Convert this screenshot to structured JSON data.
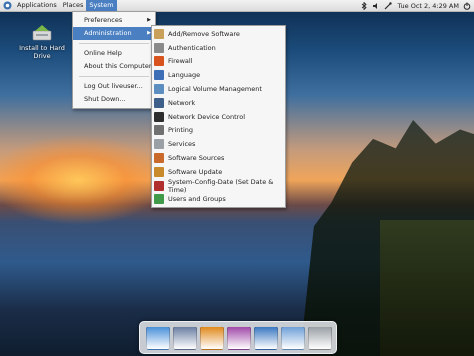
{
  "top_panel": {
    "menus": [
      {
        "label": "Applications"
      },
      {
        "label": "Places"
      },
      {
        "label": "System"
      }
    ],
    "clock": "Tue Oct 2,  4:29 AM",
    "tray_icons": [
      "bluetooth-icon",
      "speaker-icon",
      "network-icon"
    ]
  },
  "desktop": {
    "icon_label": "Install to Hard Drive"
  },
  "system_menu": {
    "items": [
      {
        "label": "Preferences",
        "has_submenu": true
      },
      {
        "label": "Administration",
        "has_submenu": true,
        "highlighted": true
      },
      {
        "label": "Online Help"
      },
      {
        "label": "About this Computer"
      },
      {
        "label": "Log Out liveuser..."
      },
      {
        "label": "Shut Down..."
      }
    ],
    "arrow_glyph": "▶"
  },
  "administration_menu": {
    "items": [
      {
        "label": "Add/Remove Software",
        "icon": "package-icon",
        "color": "#c8a05a"
      },
      {
        "label": "Authentication",
        "icon": "keys-icon",
        "color": "#8a8a8a"
      },
      {
        "label": "Firewall",
        "icon": "firewall-icon",
        "color": "#d9531e"
      },
      {
        "label": "Language",
        "icon": "language-icon",
        "color": "#3c6fb5"
      },
      {
        "label": "Logical Volume Management",
        "icon": "drive-icon",
        "color": "#5c8fc0"
      },
      {
        "label": "Network",
        "icon": "network-icon",
        "color": "#3d5f8a"
      },
      {
        "label": "Network Device Control",
        "icon": "network-device-icon",
        "color": "#2d2d2d"
      },
      {
        "label": "Printing",
        "icon": "printer-icon",
        "color": "#707070"
      },
      {
        "label": "Services",
        "icon": "services-icon",
        "color": "#9aa0a6"
      },
      {
        "label": "Software Sources",
        "icon": "software-sources-icon",
        "color": "#c96a2b"
      },
      {
        "label": "Software Update",
        "icon": "software-update-icon",
        "color": "#c98a2b"
      },
      {
        "label": "System-Config-Date (Set Date & Time)",
        "icon": "calendar-icon",
        "color": "#b03030"
      },
      {
        "label": "Users and Groups",
        "icon": "users-icon",
        "color": "#3f9a4a"
      }
    ]
  },
  "dock": {
    "items": [
      {
        "name": "web-browser-icon",
        "color": "#4a90d9"
      },
      {
        "name": "email-client-icon",
        "color": "#6b7fa3"
      },
      {
        "name": "media-player-icon",
        "color": "#e08a1e"
      },
      {
        "name": "music-player-icon",
        "color": "#a04aa8"
      },
      {
        "name": "document-editor-icon",
        "color": "#3a78c2"
      },
      {
        "name": "file-manager-icon",
        "color": "#6fa0d8"
      },
      {
        "name": "trash-icon",
        "color": "#9aa0a6"
      }
    ]
  }
}
